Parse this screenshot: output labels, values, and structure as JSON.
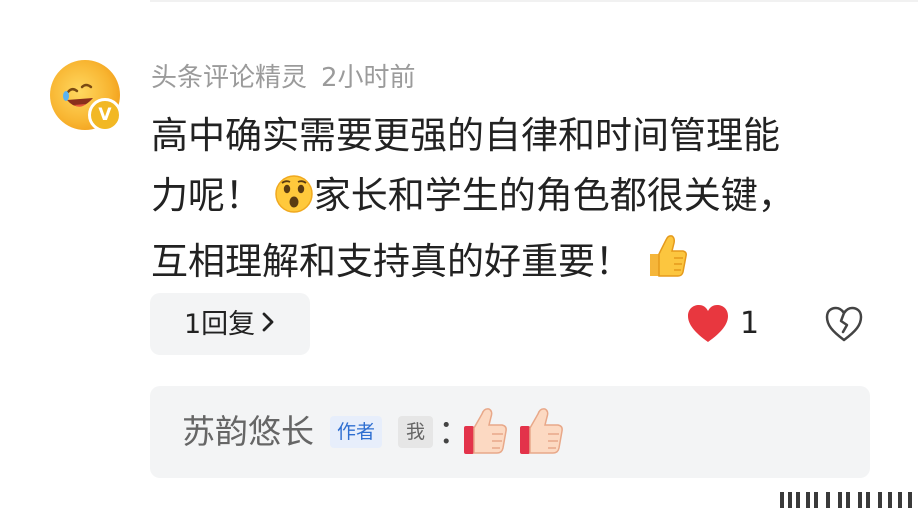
{
  "comment": {
    "author": "头条评论精灵",
    "time": "2小时前",
    "verified_badge": "V",
    "text_line1": "高中确实需要更强的自律和时间管理能",
    "text_line2_a": "力呢！",
    "text_line2_b": "家长和学生的角色都很关键，",
    "text_line3": "互相理解和支持真的好重要！",
    "emojis": [
      "astonished-face-icon",
      "thumbs-up-icon"
    ],
    "reply_button_label": "1回复",
    "like_count": "1",
    "like_color": "#e8373f"
  },
  "reply": {
    "author": "苏韵悠长",
    "author_badge": "作者",
    "me_badge": "我",
    "colon": "：",
    "emojis": [
      "thumbs-up-icon",
      "thumbs-up-icon"
    ]
  },
  "colors": {
    "meta_text": "#9b9b9b",
    "body_text": "#222222",
    "panel_bg": "#f3f4f5",
    "author_badge_text": "#2f6fd1"
  }
}
